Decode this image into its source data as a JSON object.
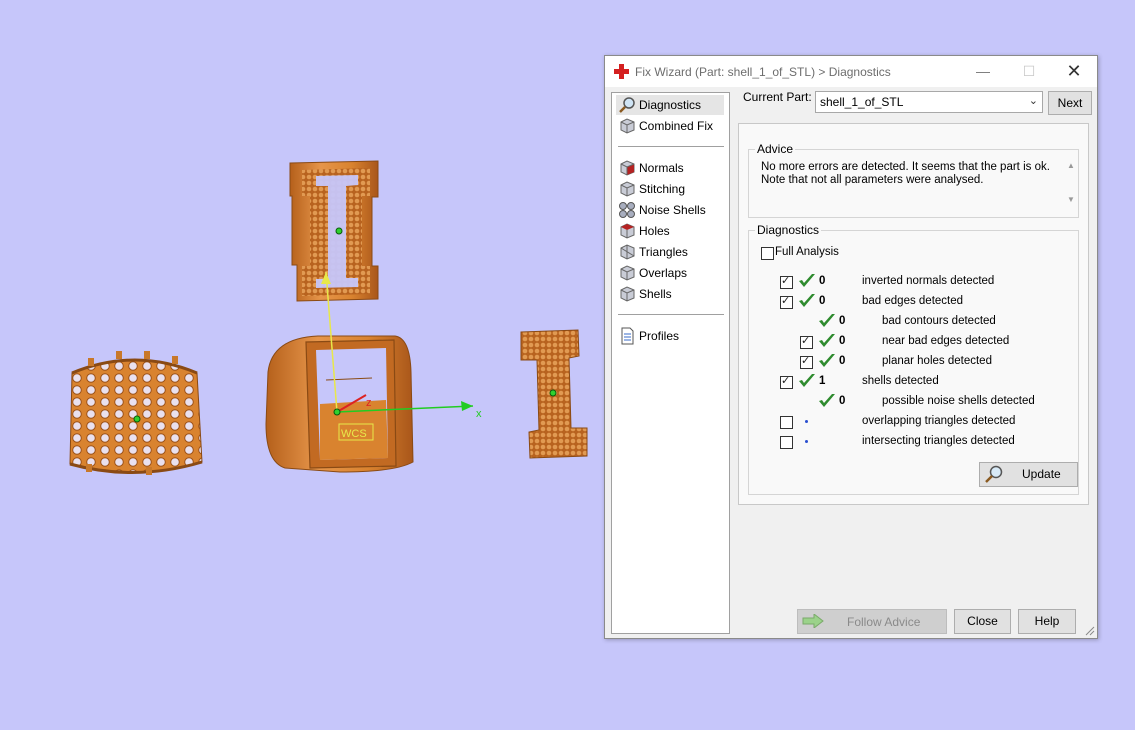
{
  "viewport": {
    "axis_x_label": "x",
    "axis_z_label": "z",
    "wcs_label": "WCS"
  },
  "dialog": {
    "title": "Fix Wizard (Part: shell_1_of_STL) > Diagnostics",
    "nav_top": [
      {
        "label": "Diagnostics",
        "icon": "magnifier-icon",
        "selected": true
      },
      {
        "label": "Combined Fix",
        "icon": "cube-icon",
        "selected": false
      }
    ],
    "nav_tools": [
      {
        "label": "Normals",
        "icon": "normals-cube-icon"
      },
      {
        "label": "Stitching",
        "icon": "stitching-cube-icon"
      },
      {
        "label": "Noise Shells",
        "icon": "noise-shells-icon"
      },
      {
        "label": "Holes",
        "icon": "holes-cube-icon"
      },
      {
        "label": "Triangles",
        "icon": "triangles-cube-icon"
      },
      {
        "label": "Overlaps",
        "icon": "overlaps-cube-icon"
      },
      {
        "label": "Shells",
        "icon": "shells-cube-icon"
      }
    ],
    "nav_bottom": [
      {
        "label": "Profiles",
        "icon": "document-icon"
      }
    ],
    "current_part_label": "Current Part:",
    "current_part_value": "shell_1_of_STL",
    "next_label": "Next",
    "advice": {
      "title": "Advice",
      "line1": "No more errors are detected. It seems that the part is ok.",
      "line2": "Note that not all parameters were analysed."
    },
    "diagnostics": {
      "title": "Diagnostics",
      "full_analysis_label": "Full Analysis",
      "full_analysis_checked": false,
      "rows": [
        {
          "checkbox": true,
          "checked": true,
          "status": "ok",
          "count": "0",
          "label": "inverted normals detected",
          "indent": 0
        },
        {
          "checkbox": true,
          "checked": true,
          "status": "ok",
          "count": "0",
          "label": "bad edges detected",
          "indent": 0
        },
        {
          "checkbox": false,
          "checked": false,
          "status": "ok",
          "count": "0",
          "label": "bad contours detected",
          "indent": 1
        },
        {
          "checkbox": true,
          "checked": true,
          "status": "ok",
          "count": "0",
          "label": "near bad edges detected",
          "indent": 1
        },
        {
          "checkbox": true,
          "checked": true,
          "status": "ok",
          "count": "0",
          "label": "planar holes detected",
          "indent": 1
        },
        {
          "checkbox": true,
          "checked": true,
          "status": "ok",
          "count": "1",
          "label": "shells detected",
          "indent": 0
        },
        {
          "checkbox": false,
          "checked": false,
          "status": "ok",
          "count": "0",
          "label": "possible noise shells detected",
          "indent": 1
        },
        {
          "checkbox": true,
          "checked": false,
          "status": "pending",
          "count": "",
          "label": "overlapping triangles detected",
          "indent": 0
        },
        {
          "checkbox": true,
          "checked": false,
          "status": "pending",
          "count": "",
          "label": "intersecting triangles detected",
          "indent": 0
        }
      ],
      "update_label": "Update"
    },
    "follow_advice_label": "Follow Advice",
    "close_label": "Close",
    "help_label": "Help"
  },
  "colors": {
    "background": "#c6c6fa",
    "part_orange": "#d9832f",
    "check_green": "#2e8b2e",
    "axis_green": "#22cc22",
    "axis_yellow": "#e8e84a",
    "axis_red": "#dd2222"
  }
}
